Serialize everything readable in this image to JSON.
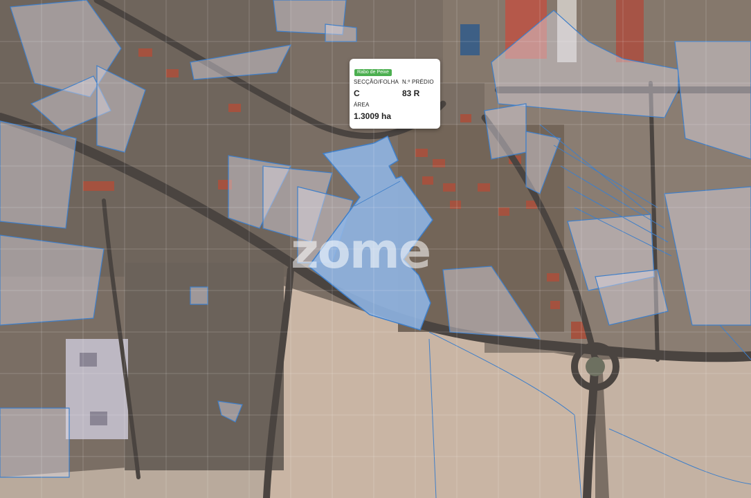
{
  "info_card": {
    "place": "Rabo de Peixe",
    "section_label": "SECÇÃO/FOLHA",
    "section_value": "C",
    "property_label": "N.º PRÉDIO",
    "property_value": "83 R",
    "area_label": "ÁREA",
    "area_value": "1.3009 ha"
  },
  "watermark": "zome",
  "colors": {
    "parcel_fill": "#8fb6e6",
    "parcel_outline": "#3f7fc9",
    "badge": "#4caf50"
  }
}
